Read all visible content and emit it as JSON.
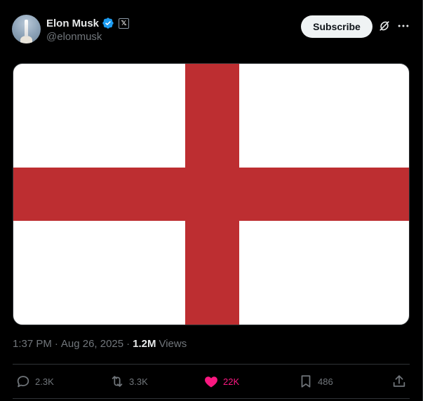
{
  "author": {
    "name": "Elon Musk",
    "handle": "@elonmusk",
    "affiliate_badge": "𝕏"
  },
  "header": {
    "subscribe_label": "Subscribe"
  },
  "media": {
    "description": "Flag of England",
    "colors": {
      "background": "#ffffff",
      "cross": "#bd2e31"
    }
  },
  "meta": {
    "time": "1:37 PM",
    "separator": "·",
    "date": "Aug 26, 2025",
    "views_count": "1.2M",
    "views_label": "Views"
  },
  "actions": {
    "replies": "2.3K",
    "reposts": "3.3K",
    "likes": "22K",
    "bookmarks": "486"
  },
  "colors": {
    "background": "#000000",
    "text_primary": "#e7e9ea",
    "text_secondary": "#71767b",
    "verified": "#1d9bf0",
    "like": "#f91880"
  }
}
